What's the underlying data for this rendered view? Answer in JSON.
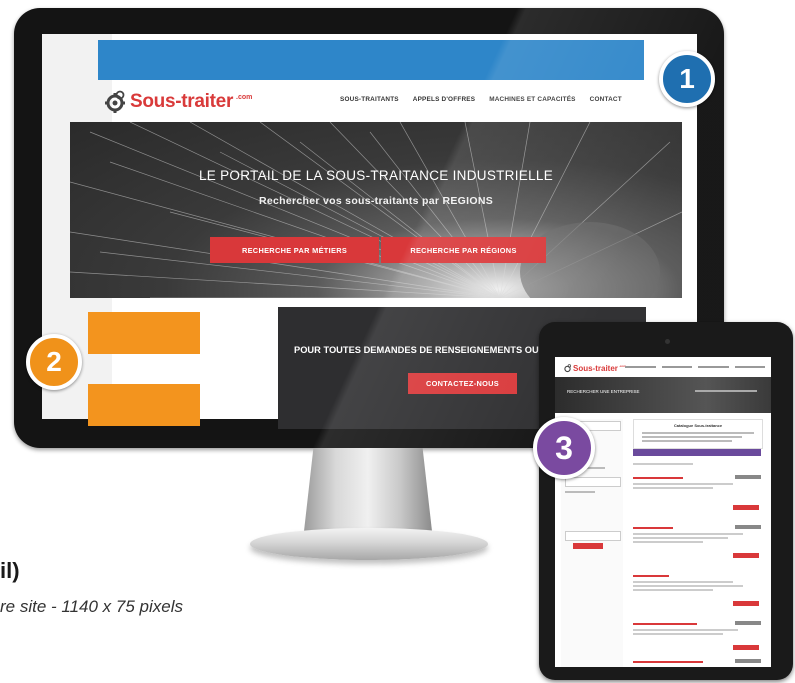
{
  "monitor": {
    "logo": {
      "name": "Sous-traiter",
      "tld": ".com"
    },
    "nav": [
      "SOUS-TRAITANTS",
      "APPELS D'OFFRES",
      "MACHINES ET CAPACITÉS",
      "CONTACT"
    ],
    "hero": {
      "title": "LE PORTAIL DE LA SOUS-TRAITANCE INDUSTRIELLE",
      "subtitle": "Rechercher vos sous-traitants par REGIONS",
      "button_metiers": "RECHERCHE PAR MÉTIERS",
      "button_regions": "RECHERCHE PAR RÉGIONS"
    },
    "contact": {
      "text": "POUR TOUTES DEMANDES DE RENSEIGNEMENTS OU",
      "button": "CONTACTEZ-NOUS"
    }
  },
  "badges": {
    "one": "1",
    "two": "2",
    "three": "3"
  },
  "caption": {
    "title": "il)",
    "subtitle": "re site - 1140 x 75 pixels"
  },
  "tablet": {
    "logo": {
      "name": "Sous-traiter",
      "tld": ".com"
    },
    "hero_title": "RECHERCHER UNE ENTREPRISE",
    "box_title": "Catalogue Sous-traitance"
  },
  "colors": {
    "banner_blue": "#2e86c9",
    "accent_red": "#d9383a",
    "ad_orange": "#f3941e",
    "badge_blue": "#1f6fb0",
    "badge_orange": "#f0921a",
    "badge_purple": "#7a4aa0",
    "dark_panel": "#2e2e30"
  }
}
